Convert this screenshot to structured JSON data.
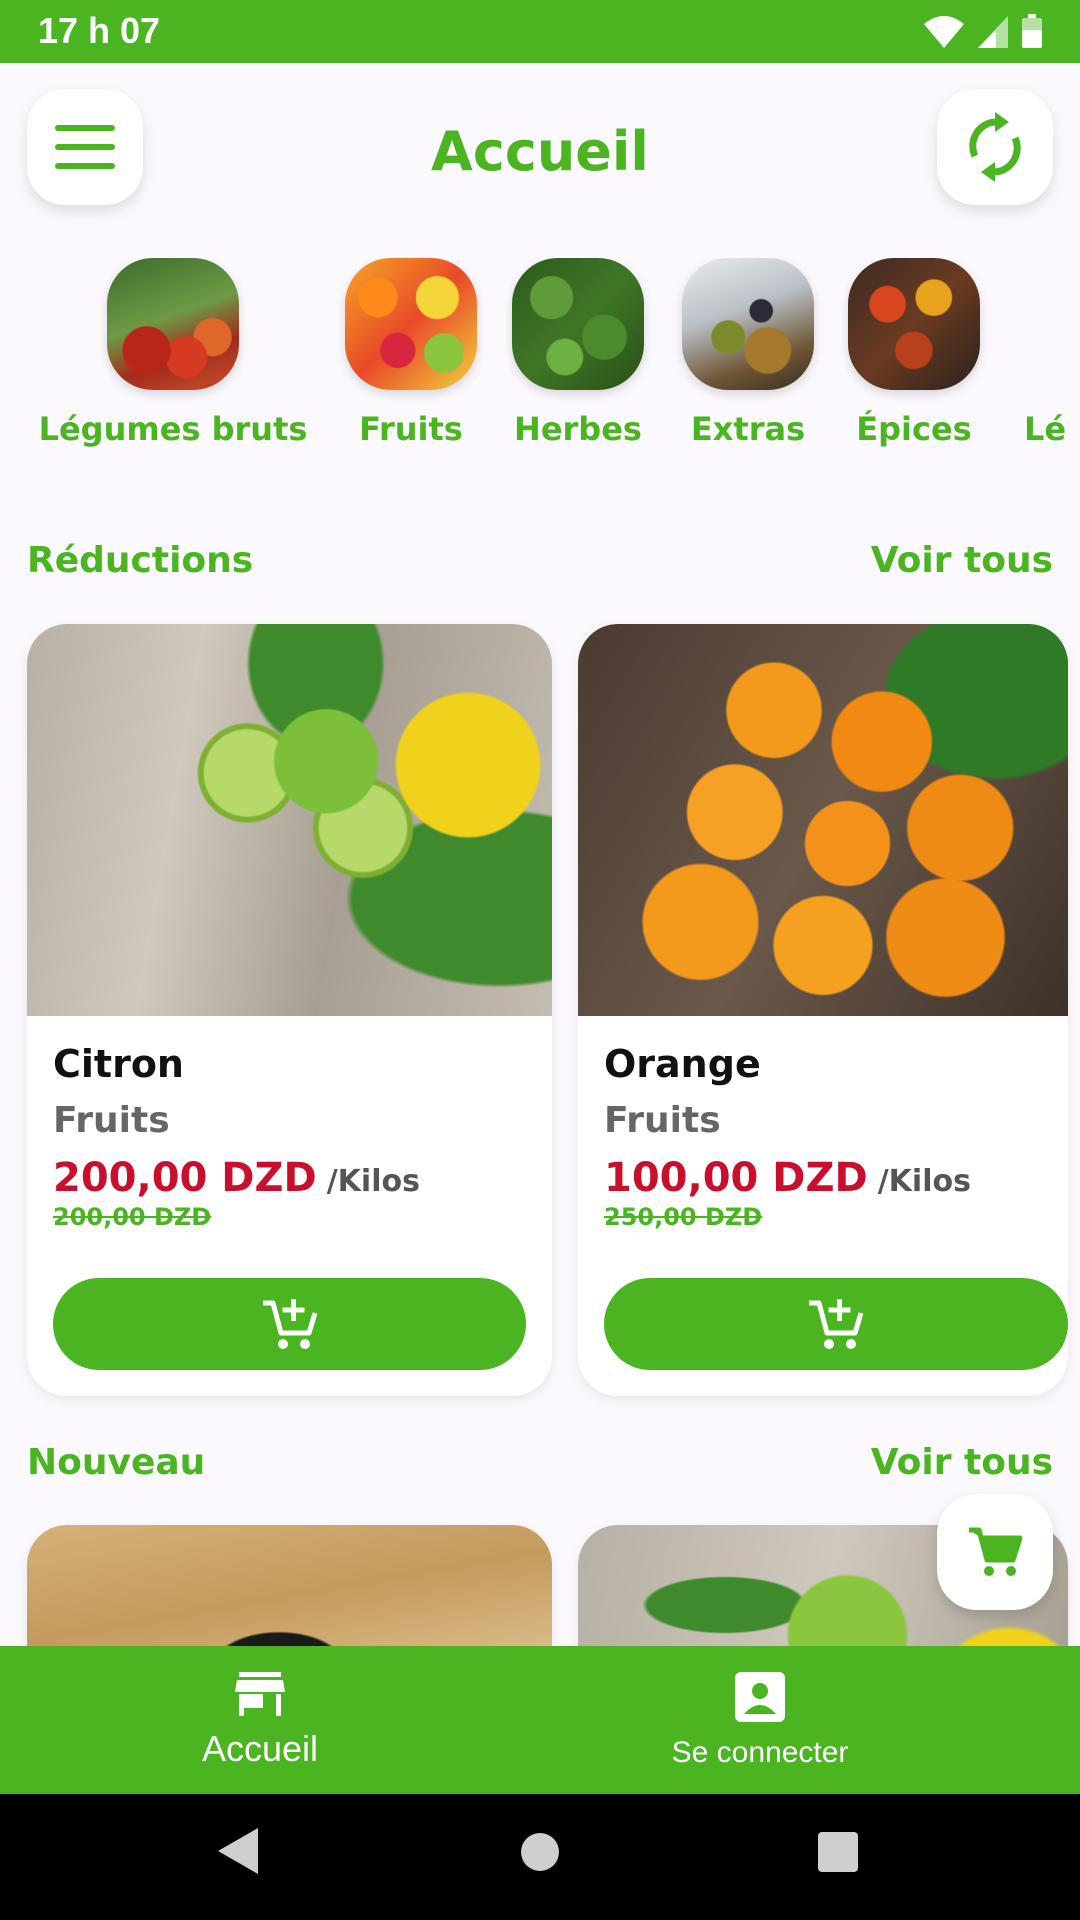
{
  "status_bar": {
    "time": "17 h 07"
  },
  "header": {
    "title": "Accueil"
  },
  "categories": [
    {
      "label": "Légumes bruts",
      "icon": "vegetables-image"
    },
    {
      "label": "Fruits",
      "icon": "fruits-image"
    },
    {
      "label": "Herbes",
      "icon": "herbs-image"
    },
    {
      "label": "Extras",
      "icon": "olives-image"
    },
    {
      "label": "Épices",
      "icon": "spices-image"
    },
    {
      "label": "Lé",
      "icon": ""
    }
  ],
  "reductions": {
    "title": "Réductions",
    "see_all": "Voir tous",
    "products": [
      {
        "name": "Citron",
        "category": "Fruits",
        "price": "200,00 DZD",
        "unit": "/Kilos",
        "old_price": "200,00 DZD"
      },
      {
        "name": "Orange",
        "category": "Fruits",
        "price": "100,00 DZD",
        "unit": "/Kilos",
        "old_price": "250,00 DZD"
      }
    ]
  },
  "nouveau": {
    "title": "Nouveau",
    "see_all": "Voir tous"
  },
  "bottom_nav": {
    "home": "Accueil",
    "login": "Se connecter"
  },
  "colors": {
    "brand_green": "#4ab520",
    "price_red": "#c8102e"
  }
}
